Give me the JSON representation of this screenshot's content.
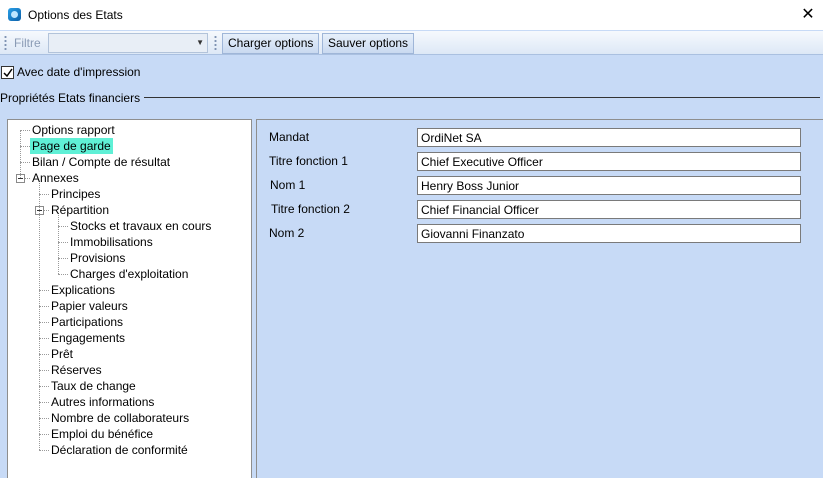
{
  "window": {
    "title": "Options des Etats"
  },
  "toolbar": {
    "filter_label": "Filtre",
    "filter_value": "",
    "load_label": "Charger options",
    "save_label": "Sauver options"
  },
  "options": {
    "print_date_label": "Avec date d'impression",
    "print_date_checked": true
  },
  "group": {
    "title": "Propriétés Etats financiers"
  },
  "tree": {
    "items": [
      {
        "label": "Options rapport",
        "level": 0
      },
      {
        "label": "Page de garde",
        "level": 0,
        "selected": true
      },
      {
        "label": "Bilan / Compte de résultat",
        "level": 0
      },
      {
        "label": "Annexes",
        "level": 0,
        "expanded": true
      },
      {
        "label": "Principes",
        "level": 1
      },
      {
        "label": "Répartition",
        "level": 1,
        "expanded": true
      },
      {
        "label": "Stocks et travaux en cours",
        "level": 2
      },
      {
        "label": "Immobilisations",
        "level": 2
      },
      {
        "label": "Provisions",
        "level": 2
      },
      {
        "label": "Charges d'exploitation",
        "level": 2
      },
      {
        "label": "Explications",
        "level": 1
      },
      {
        "label": "Papier valeurs",
        "level": 1
      },
      {
        "label": "Participations",
        "level": 1
      },
      {
        "label": "Engagements",
        "level": 1
      },
      {
        "label": "Prêt",
        "level": 1
      },
      {
        "label": "Réserves",
        "level": 1
      },
      {
        "label": "Taux de change",
        "level": 1
      },
      {
        "label": "Autres informations",
        "level": 1
      },
      {
        "label": "Nombre de collaborateurs",
        "level": 1
      },
      {
        "label": "Emploi du bénéfice",
        "level": 1
      },
      {
        "label": "Déclaration de conformité",
        "level": 1
      }
    ]
  },
  "form": {
    "fields": [
      {
        "label": "Mandat",
        "value": "OrdiNet SA"
      },
      {
        "label": "Titre fonction 1",
        "value": "Chief Executive Officer"
      },
      {
        "label": "Nom 1",
        "value": "Henry Boss Junior"
      },
      {
        "label": "Titre fonction 2",
        "value": "Chief Financial Officer"
      },
      {
        "label": "Nom 2",
        "value": "Giovanni Finanzato"
      }
    ]
  },
  "colors": {
    "background": "#c7daf6",
    "selection": "#5ff0d6"
  }
}
